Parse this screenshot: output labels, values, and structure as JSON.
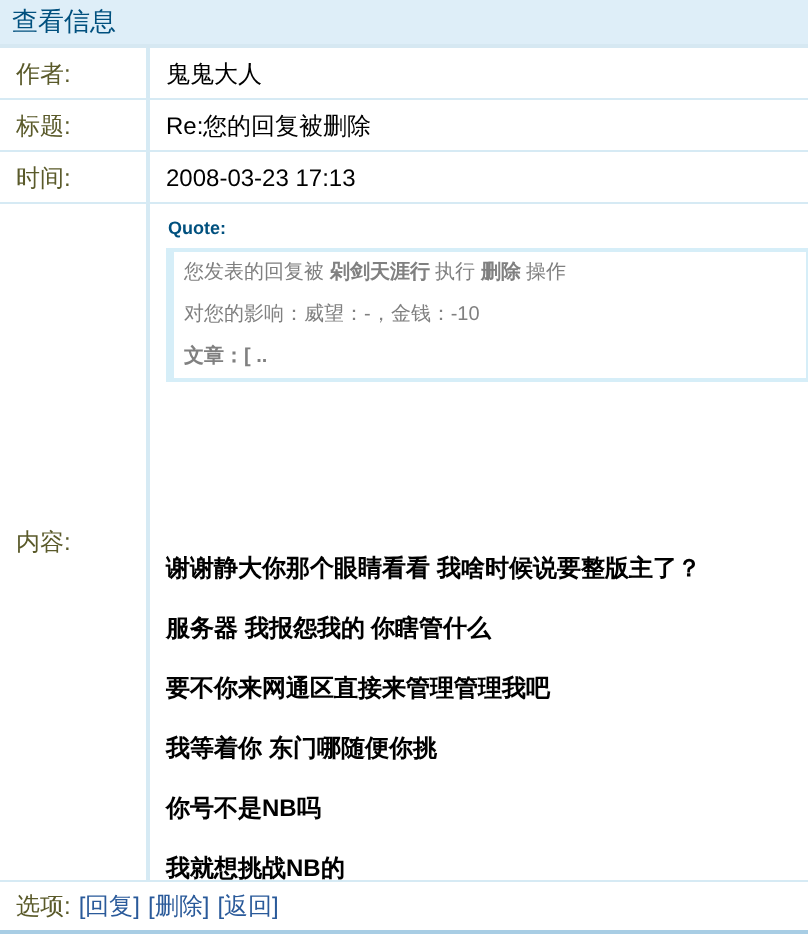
{
  "title": "查看信息",
  "fields": [
    {
      "label": "作者:",
      "value": "鬼鬼大人"
    },
    {
      "label": "标题:",
      "value": "Re:您的回复被删除"
    },
    {
      "label": "时间:",
      "value": "2008-03-23 17:13"
    }
  ],
  "content": {
    "label": "内容:",
    "quote": {
      "heading": "Quote:",
      "lines": [
        "您发表的回复被 **剁剑天涯行** 执行 **删除** 操作",
        "对您的影响：威望：-，金钱：-10",
        "**文章：[ ..**"
      ]
    },
    "paragraphs": [
      "谢谢静大你那个眼睛看看 我啥时候说要整版主了？",
      "服务器 我报怨我的 你瞎管什么",
      "要不你来网通区直接来管理管理我吧",
      "我等着你 东门哪随便你挑",
      "你号不是NB吗",
      "我就想挑战NB的"
    ]
  },
  "options": {
    "label": "选项:",
    "links": [
      "[回复]",
      "[删除]",
      "[返回]"
    ]
  }
}
